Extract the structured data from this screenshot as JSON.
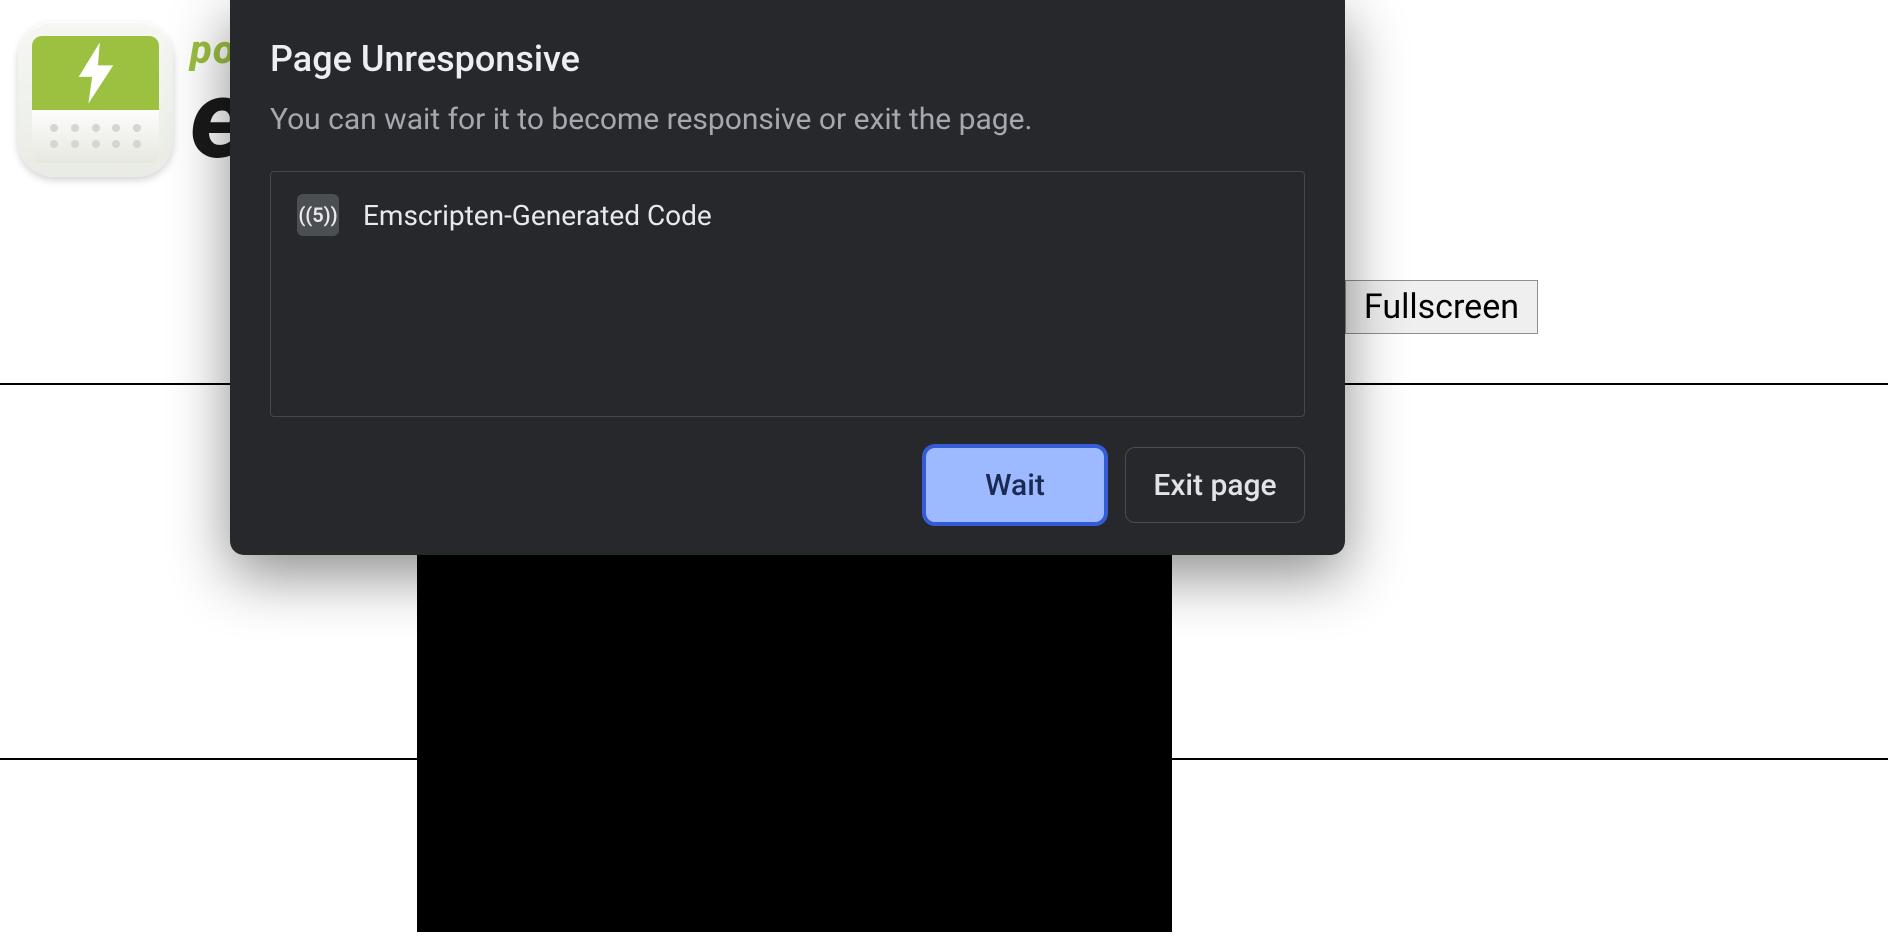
{
  "page": {
    "wordmark_small": "po",
    "wordmark_big": "e",
    "fullscreen_label": "Fullscreen"
  },
  "dialog": {
    "title": "Page Unresponsive",
    "message": "You can wait for it to become responsive or exit the page.",
    "process": {
      "favicon_label": "((5))",
      "name": "Emscripten-Generated Code"
    },
    "buttons": {
      "wait": "Wait",
      "exit": "Exit page"
    }
  }
}
